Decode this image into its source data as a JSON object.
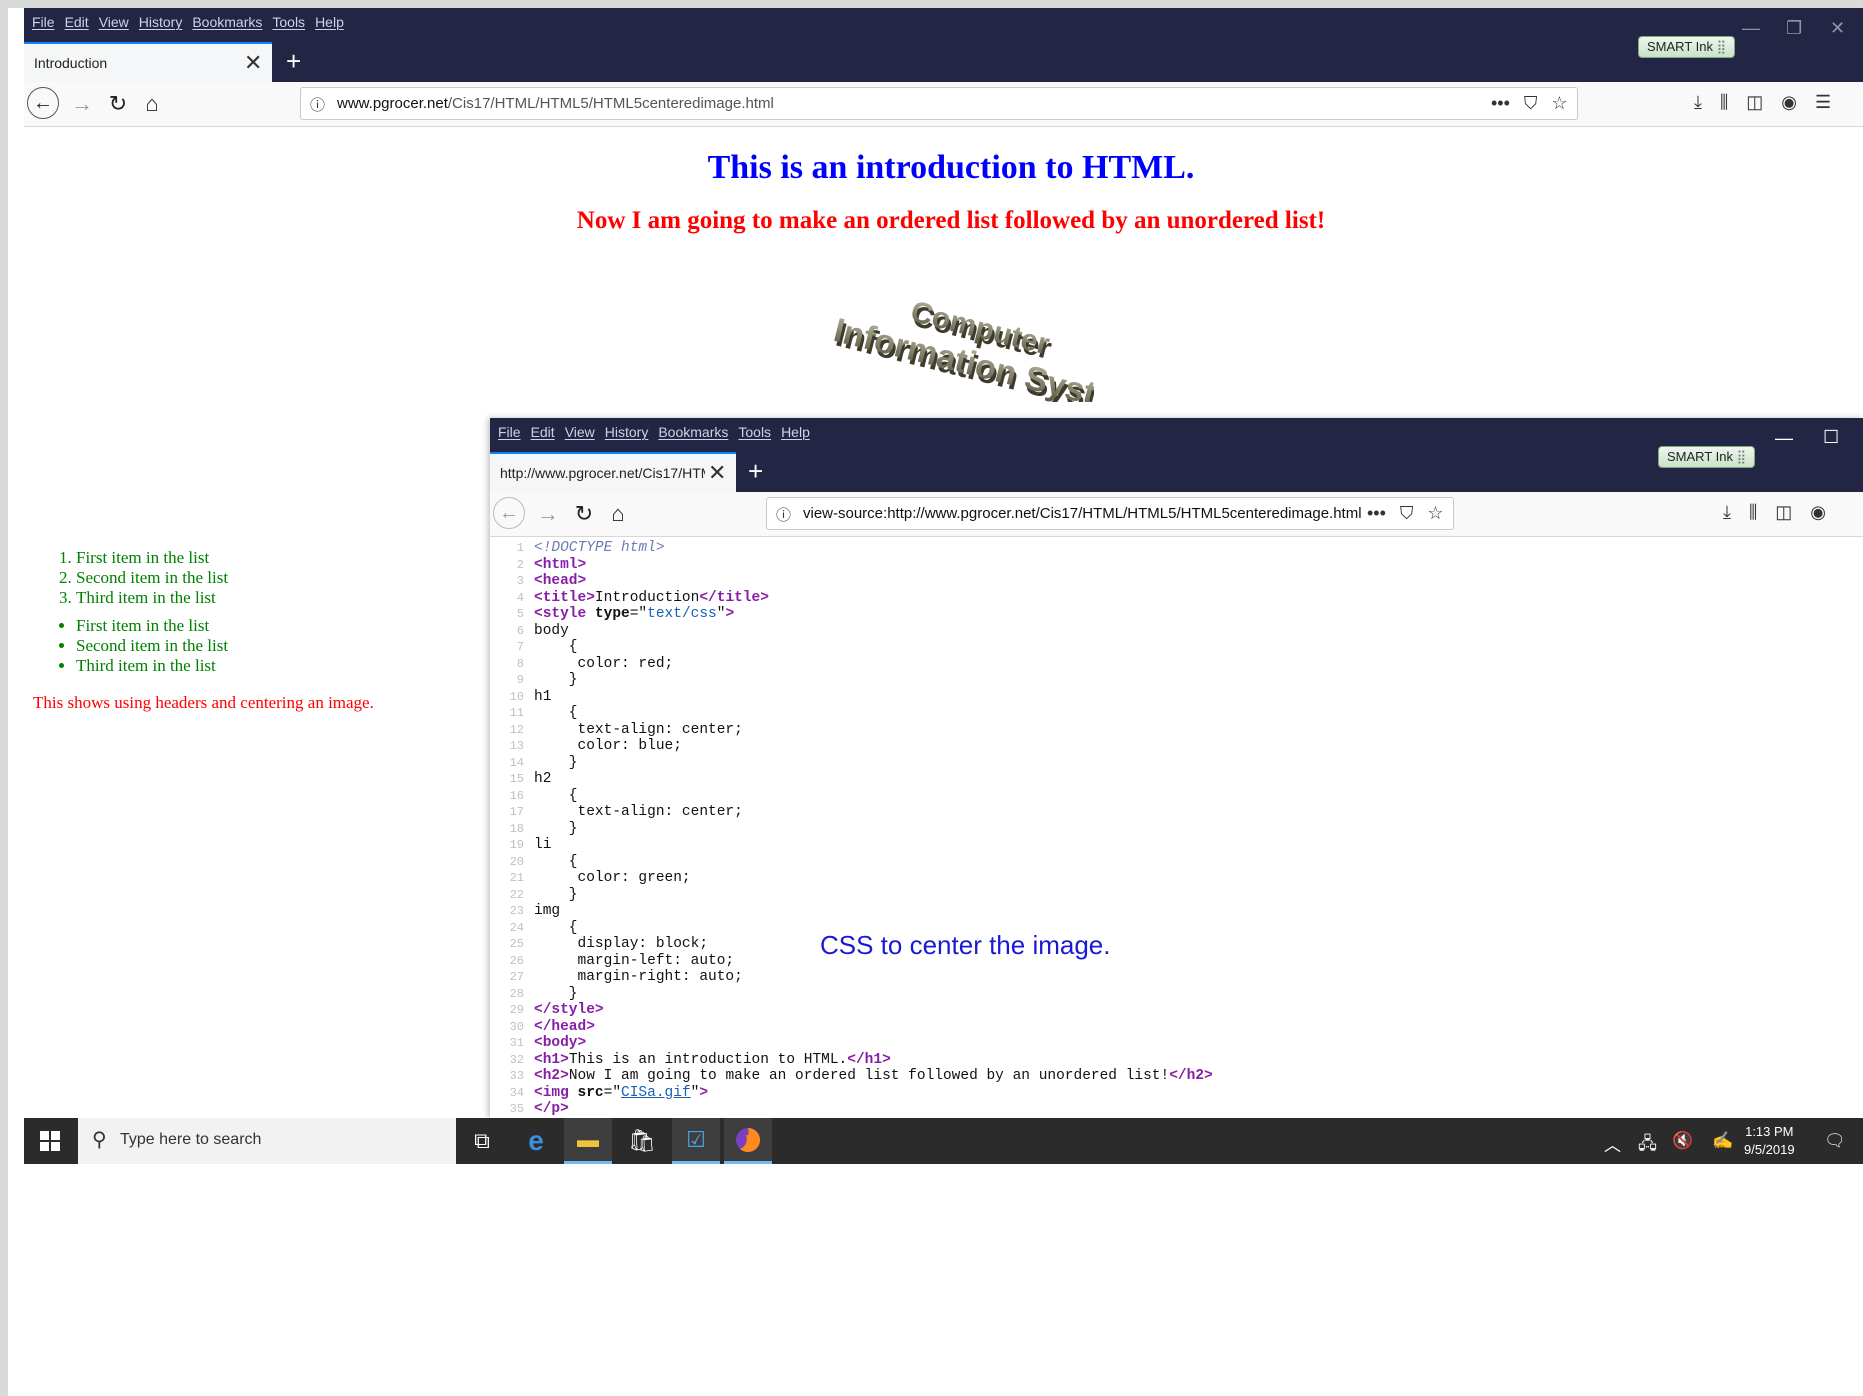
{
  "main_browser": {
    "menu": [
      "File",
      "Edit",
      "View",
      "History",
      "Bookmarks",
      "Tools",
      "Help"
    ],
    "tab_title": "Introduction",
    "url_domain": "www.pgrocer.net",
    "url_path": "/Cis17/HTML/HTML5/HTML5centeredimage.html",
    "smart_ink": "SMART Ink"
  },
  "page": {
    "h1": "This is an introduction to HTML.",
    "h2": "Now I am going to make an ordered list followed by an unordered list!",
    "image_alt": "Computer Information Systems",
    "ordered_list": [
      "First item in the list",
      "Second item in the list",
      "Third item in the list"
    ],
    "unordered_list": [
      "First item in the list",
      "Second item in the list",
      "Third item in the list"
    ],
    "footer_text": "This shows using headers and centering an image."
  },
  "source_window": {
    "menu": [
      "File",
      "Edit",
      "View",
      "History",
      "Bookmarks",
      "Tools",
      "Help"
    ],
    "tab_title": "http://www.pgrocer.net/Cis17/HTM",
    "url": "view-source:http://www.pgrocer.net/Cis17/HTML/HTML5/HTML5centeredimage.html",
    "smart_ink": "SMART Ink",
    "annotation": "CSS to center the image.",
    "code_lines": [
      [
        {
          "t": "comment",
          "v": "<!DOCTYPE html>"
        }
      ],
      [
        {
          "t": "tag",
          "v": "<html>"
        }
      ],
      [
        {
          "t": "tag",
          "v": "<head>"
        }
      ],
      [
        {
          "t": "tag",
          "v": "<title>"
        },
        {
          "t": "text",
          "v": "Introduction"
        },
        {
          "t": "tag",
          "v": "</title>"
        }
      ],
      [
        {
          "t": "tag",
          "v": "<style "
        },
        {
          "t": "attr",
          "v": "type"
        },
        {
          "t": "text",
          "v": "=\""
        },
        {
          "t": "val",
          "v": "text/css"
        },
        {
          "t": "text",
          "v": "\""
        },
        {
          "t": "tag",
          "v": ">"
        }
      ],
      [
        {
          "t": "text",
          "v": "body"
        }
      ],
      [
        {
          "t": "text",
          "v": "    {"
        }
      ],
      [
        {
          "t": "text",
          "v": "     color: red;"
        }
      ],
      [
        {
          "t": "text",
          "v": "    }"
        }
      ],
      [
        {
          "t": "text",
          "v": "h1"
        }
      ],
      [
        {
          "t": "text",
          "v": "    {"
        }
      ],
      [
        {
          "t": "text",
          "v": "     text-align: center;"
        }
      ],
      [
        {
          "t": "text",
          "v": "     color: blue;"
        }
      ],
      [
        {
          "t": "text",
          "v": "    }"
        }
      ],
      [
        {
          "t": "text",
          "v": "h2"
        }
      ],
      [
        {
          "t": "text",
          "v": "    {"
        }
      ],
      [
        {
          "t": "text",
          "v": "     text-align: center;"
        }
      ],
      [
        {
          "t": "text",
          "v": "    }"
        }
      ],
      [
        {
          "t": "text",
          "v": "li"
        }
      ],
      [
        {
          "t": "text",
          "v": "    {"
        }
      ],
      [
        {
          "t": "text",
          "v": "     color: green;"
        }
      ],
      [
        {
          "t": "text",
          "v": "    }"
        }
      ],
      [
        {
          "t": "text",
          "v": "img"
        }
      ],
      [
        {
          "t": "text",
          "v": "    {"
        }
      ],
      [
        {
          "t": "text",
          "v": "     display: block;"
        }
      ],
      [
        {
          "t": "text",
          "v": "     margin-left: auto;"
        }
      ],
      [
        {
          "t": "text",
          "v": "     margin-right: auto;"
        }
      ],
      [
        {
          "t": "text",
          "v": "    }"
        }
      ],
      [
        {
          "t": "tag",
          "v": "</style>"
        }
      ],
      [
        {
          "t": "tag",
          "v": "</head>"
        }
      ],
      [
        {
          "t": "tag",
          "v": "<body>"
        }
      ],
      [
        {
          "t": "tag",
          "v": "<h1>"
        },
        {
          "t": "text",
          "v": "This is an introduction to HTML."
        },
        {
          "t": "tag",
          "v": "</h1>"
        }
      ],
      [
        {
          "t": "tag",
          "v": "<h2>"
        },
        {
          "t": "text",
          "v": "Now I am going to make an ordered list followed by an unordered list!"
        },
        {
          "t": "tag",
          "v": "</h2>"
        }
      ],
      [
        {
          "t": "tag",
          "v": "<img "
        },
        {
          "t": "attr",
          "v": "src"
        },
        {
          "t": "text",
          "v": "=\""
        },
        {
          "t": "link",
          "v": "CISa.gif"
        },
        {
          "t": "text",
          "v": "\""
        },
        {
          "t": "tag",
          "v": ">"
        }
      ],
      [
        {
          "t": "tag",
          "v": "</p>"
        }
      ]
    ]
  },
  "taskbar": {
    "search_placeholder": "Type here to search",
    "time": "1:13 PM",
    "date": "9/5/2019"
  }
}
